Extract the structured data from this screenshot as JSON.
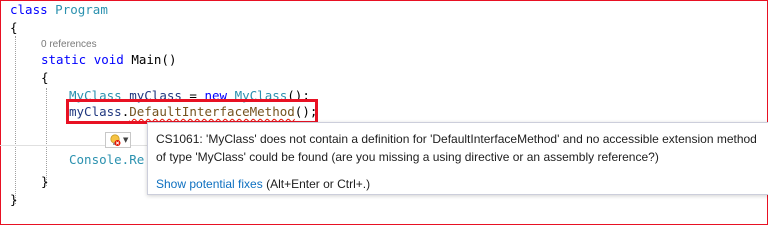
{
  "code": {
    "class_keyword": "class",
    "class_name": "Program",
    "open_brace_outer": "{",
    "codelens": "0 references",
    "static_kw": "static",
    "void_kw": "void",
    "main_sig": "Main()",
    "open_brace_inner": "{",
    "decl_type": "MyClass",
    "decl_var": "myClass",
    "decl_eq": " = ",
    "decl_new": "new",
    "decl_ctor": "MyClass",
    "decl_end": "();",
    "call_obj": "myClass",
    "call_dot": ".",
    "call_method": "DefaultInterfaceMethod",
    "call_end": "();",
    "console_partial": "Console.Re",
    "close_brace_inner": "}",
    "close_brace_outer": "}"
  },
  "tooltip": {
    "line1": "CS1061: 'MyClass' does not contain a definition for 'DefaultInterfaceMethod' and no accessible extension method",
    "line2": "of type 'MyClass' could be found (are you missing a using directive or an assembly reference?)",
    "fix_link": "Show potential fixes",
    "fix_hint": " (Alt+Enter or Ctrl+.)"
  },
  "colors": {
    "keyword": "#0000ff",
    "type": "#2b91af",
    "highlight_border": "#e81123",
    "error_squiggle": "#e51400",
    "link": "#0e70c0"
  },
  "icons": {
    "quick_actions": "lightbulb-error-icon",
    "dropdown": "chevron-down-icon"
  }
}
